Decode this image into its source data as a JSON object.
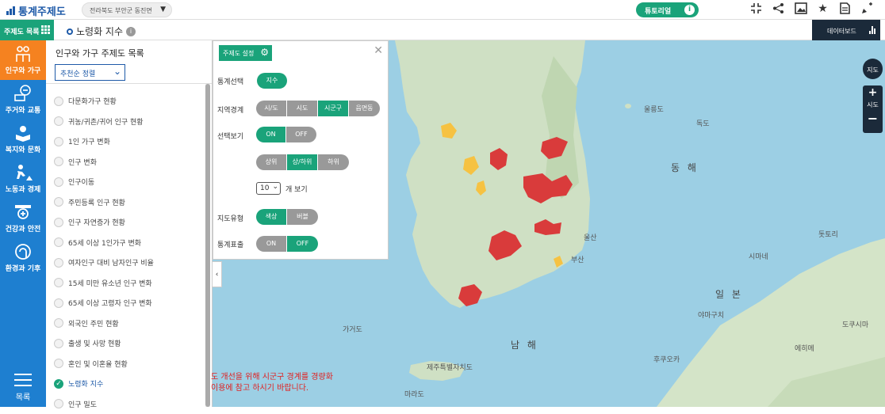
{
  "app": {
    "title": "통계주제도"
  },
  "region_selector": {
    "value": "전라북도 부안군 동진면"
  },
  "tutorial": {
    "label": "튜토리얼",
    "icon": "info-icon"
  },
  "toolbar": {
    "icons": [
      "shrink-icon",
      "share-icon",
      "image-icon",
      "star-icon",
      "document-icon",
      "pin-icon"
    ]
  },
  "toc": {
    "label": "주제도 목록",
    "icon": "grid-icon"
  },
  "map_title": {
    "text": "노령화 지수",
    "icon": "info-icon"
  },
  "dashboard": {
    "label": "데이터보드",
    "icon": "bar-chart-icon"
  },
  "sidebar": {
    "items": [
      {
        "label": "인구와 가구",
        "icon": "people-icon"
      },
      {
        "label": "주거와 교통",
        "icon": "bus-icon"
      },
      {
        "label": "복지와 문화",
        "icon": "book-icon"
      },
      {
        "label": "노동과 경제",
        "icon": "worker-icon"
      },
      {
        "label": "건강과 안전",
        "icon": "health-icon"
      },
      {
        "label": "환경과 기후",
        "icon": "environment-icon"
      }
    ],
    "menu_label": "목록"
  },
  "panel": {
    "title": "인구와 가구 주제도 목록",
    "sort": "추천순 정렬",
    "items": [
      "다문화가구 현황",
      "귀농/귀촌/귀어 인구 현황",
      "1인 가구 변화",
      "인구 변화",
      "인구이동",
      "주민등록 인구 현황",
      "인구 자연증가 현황",
      "65세 이상 1인가구 변화",
      "여자인구 대비 남자인구 비율",
      "15세 미만 유소년 인구 변화",
      "65세 이상 고령자 인구 변화",
      "외국인 주민 현황",
      "출생 및 사망 현황",
      "혼인 및 이혼율 현황",
      "노령화 지수",
      "인구 밀도"
    ],
    "checked_index": 14
  },
  "settings": {
    "button": "주제도 설정",
    "stat_label": "통계선택",
    "stat_value": "지수",
    "region_label": "지역경계",
    "region_options": [
      "시/도",
      "시도",
      "시군구",
      "읍면동"
    ],
    "region_on": 2,
    "select_label": "선택보기",
    "select_options": [
      "ON",
      "OFF"
    ],
    "select_on": 0,
    "rank_options": [
      "상위",
      "상/하위",
      "하위"
    ],
    "rank_on": 1,
    "count_value": "10",
    "count_unit": "개 보기",
    "maptype_label": "지도유형",
    "maptype_options": [
      "색상",
      "버블"
    ],
    "maptype_on": 0,
    "expr_label": "통계표출",
    "expr_options": [
      "ON",
      "OFF"
    ],
    "expr_on": 1
  },
  "notice": {
    "line1": "도 개선을 위해 시군구 경계를 경량화",
    "line2": "이용에 참고 하시기 바랍니다."
  },
  "map_controls": {
    "map_label": "지도",
    "zoom_label": "시도"
  },
  "map_labels": {
    "east_sea": "동 해",
    "south_sea": "남 해",
    "japan": "일 본",
    "places": [
      "울릉도",
      "독도",
      "울산",
      "부산",
      "가거도",
      "제주특별자치도",
      "마라도",
      "시마네",
      "돗토리",
      "야마구치",
      "후쿠오카",
      "도쿠시마",
      "에히메"
    ]
  },
  "colors": {
    "accent": "#1aa37a",
    "primary": "#1e7fd0",
    "active": "#f58220",
    "highlight": "#d93b3b"
  }
}
